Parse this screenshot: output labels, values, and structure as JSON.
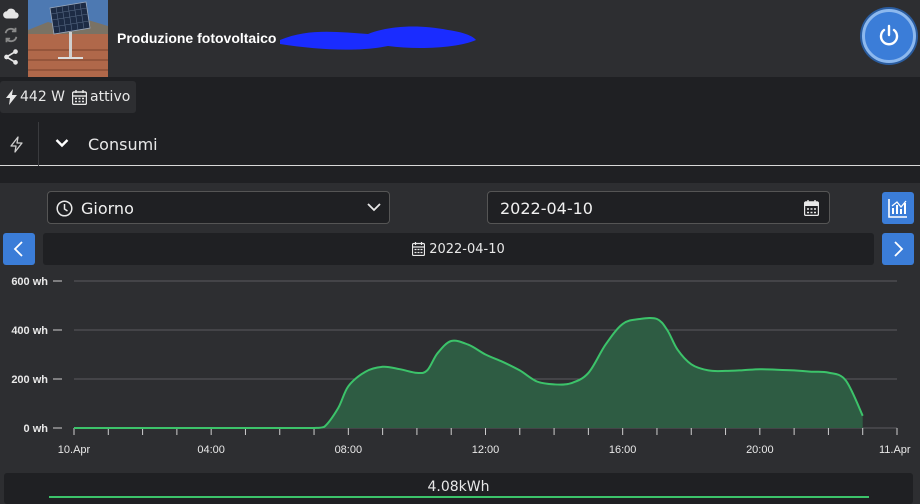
{
  "header": {
    "device_title": "Produzione fotovoltaico"
  },
  "icons": {
    "cloud": "cloud-icon",
    "sync": "sync-icon",
    "share": "share-icon",
    "power": "power-icon"
  },
  "colors": {
    "accent": "#3b7dd8",
    "series": "#3cc36a",
    "series_fill": "#2e5c43"
  },
  "badges": {
    "power_value": "442 W",
    "status": "attivo"
  },
  "section": {
    "label": "Consumi"
  },
  "controls": {
    "period_selected": "Giorno",
    "date_value": "2022-04-10",
    "date_bar": "2022-04-10"
  },
  "total": {
    "label": "4.08kWh"
  },
  "chart_data": {
    "type": "area",
    "y_unit": "wh",
    "ylim": [
      0,
      600
    ],
    "yticks": [
      {
        "value": 0,
        "label": "0 wh"
      },
      {
        "value": 200,
        "label": "200 wh"
      },
      {
        "value": 400,
        "label": "400 wh"
      },
      {
        "value": 600,
        "label": "600 wh"
      }
    ],
    "xlim": [
      0,
      24
    ],
    "xticks": [
      {
        "value": 0,
        "label": "10.Apr"
      },
      {
        "value": 4,
        "label": "04:00"
      },
      {
        "value": 8,
        "label": "08:00"
      },
      {
        "value": 12,
        "label": "12:00"
      },
      {
        "value": 16,
        "label": "16:00"
      },
      {
        "value": 20,
        "label": "20:00"
      },
      {
        "value": 24,
        "label": "11.Apr"
      }
    ],
    "grid": true,
    "series": [
      {
        "x": [
          0,
          6,
          7.0,
          7.3,
          7.7,
          8.0,
          8.5,
          9.0,
          9.5,
          10.0,
          10.3,
          10.6,
          11.0,
          11.5,
          12.0,
          12.5,
          13.0,
          13.5,
          14.0,
          14.5,
          15.0,
          15.5,
          16.0,
          16.5,
          17.0,
          17.3,
          17.6,
          18.0,
          18.5,
          19.0,
          19.5,
          20.0,
          20.5,
          21.0,
          21.5,
          22.0,
          22.5,
          23.0
        ],
        "y": [
          0,
          0,
          0,
          5,
          80,
          170,
          230,
          250,
          240,
          225,
          235,
          305,
          355,
          340,
          300,
          270,
          235,
          190,
          178,
          183,
          225,
          340,
          425,
          445,
          445,
          400,
          320,
          260,
          235,
          233,
          236,
          240,
          238,
          235,
          230,
          226,
          195,
          50
        ]
      }
    ]
  }
}
